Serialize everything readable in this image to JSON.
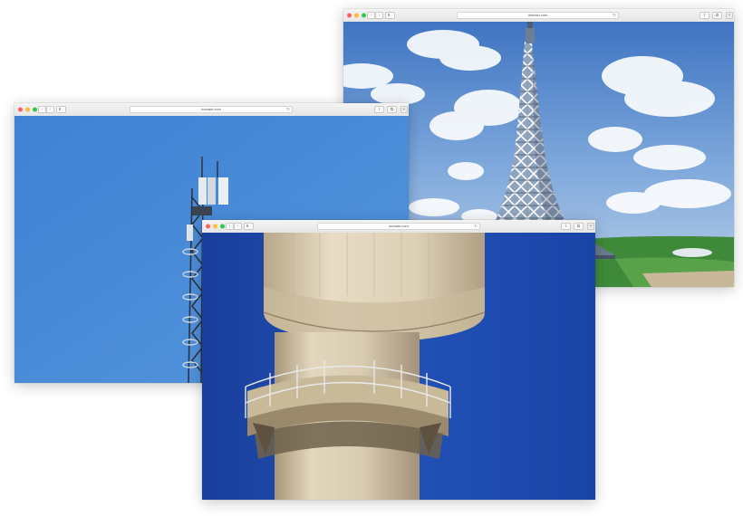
{
  "windows": [
    {
      "id": "spire",
      "url": "domain.com",
      "photo": {
        "subject": "lattice-spire-tower",
        "sky": "#5a8fd0"
      }
    },
    {
      "id": "antenna",
      "url": "domain.com",
      "photo": {
        "subject": "antenna-mast",
        "sky": "#4a8ad8"
      }
    },
    {
      "id": "water",
      "url": "domain.com",
      "photo": {
        "subject": "concrete-tower-balcony",
        "sky": "#1d49ad"
      }
    }
  ],
  "icons": {
    "back": "‹",
    "forward": "›",
    "reload": "↻",
    "share": "⇧",
    "tabs": "⧉",
    "new_tab": "+"
  }
}
